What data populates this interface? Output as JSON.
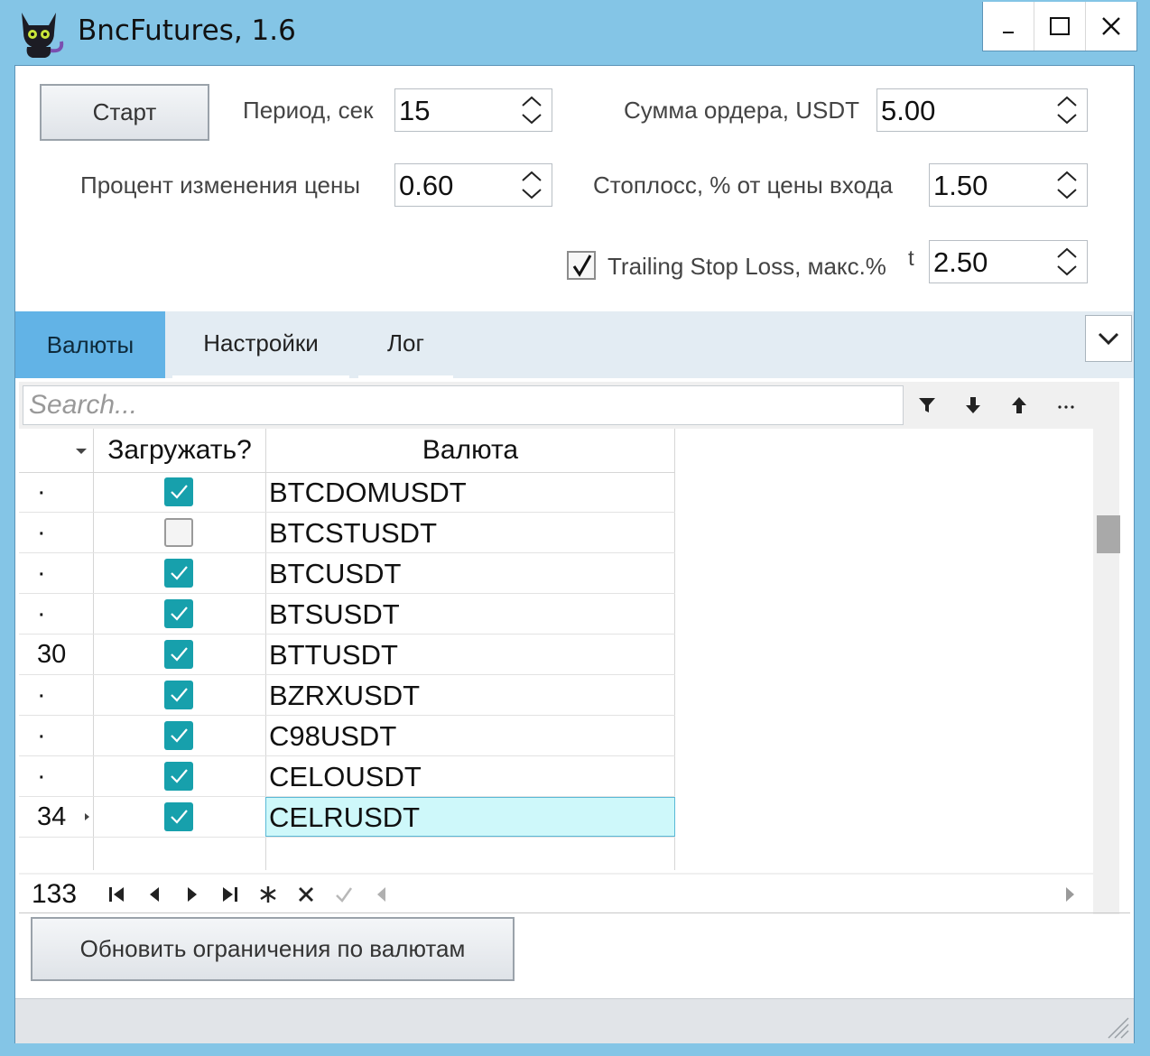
{
  "window": {
    "title": "BncFutures, 1.6",
    "controls": {
      "minimize": "–",
      "maximize": "☐",
      "close": "✕"
    }
  },
  "settings": {
    "start_button": "Старт",
    "period_label": "Период, сек",
    "period_value": "15",
    "order_sum_label": "Сумма ордера, USDT",
    "order_sum_value": "5.00",
    "price_change_label": "Процент изменения цены",
    "price_change_value": "0.60",
    "stoploss_label": "Стоплосс, % от цены входа",
    "stoploss_value": "1.50",
    "trailing_label": "Trailing Stop Loss, макс.%",
    "trailing_suffix": "t",
    "trailing_checked": true,
    "trailing_value": "2.50"
  },
  "tabs": [
    {
      "label": "Валюты",
      "active": true
    },
    {
      "label": "Настройки",
      "active": false
    },
    {
      "label": "Лог",
      "active": false
    }
  ],
  "grid": {
    "search_placeholder": "Search...",
    "columns": {
      "load": "Загружать?",
      "currency": "Валюта"
    },
    "rows": [
      {
        "indicator": "·",
        "load": true,
        "currency": "BTCDOMUSDT"
      },
      {
        "indicator": "·",
        "load": false,
        "currency": "BTCSTUSDT"
      },
      {
        "indicator": "·",
        "load": true,
        "currency": "BTCUSDT"
      },
      {
        "indicator": "·",
        "load": true,
        "currency": "BTSUSDT"
      },
      {
        "indicator": "30",
        "load": true,
        "currency": "BTTUSDT"
      },
      {
        "indicator": "·",
        "load": true,
        "currency": "BZRXUSDT"
      },
      {
        "indicator": "·",
        "load": true,
        "currency": "C98USDT"
      },
      {
        "indicator": "·",
        "load": true,
        "currency": "CELOUSDT"
      },
      {
        "indicator": "34",
        "load": true,
        "currency": "CELRUSDT",
        "selected": true
      }
    ],
    "record_count": "133"
  },
  "actions": {
    "update_button": "Обновить ограничения по валютам"
  },
  "colors": {
    "accent": "#62b3e6",
    "checkbox_on": "#17a0ac",
    "selection": "#cef8fa",
    "frame": "#84c5e6"
  }
}
